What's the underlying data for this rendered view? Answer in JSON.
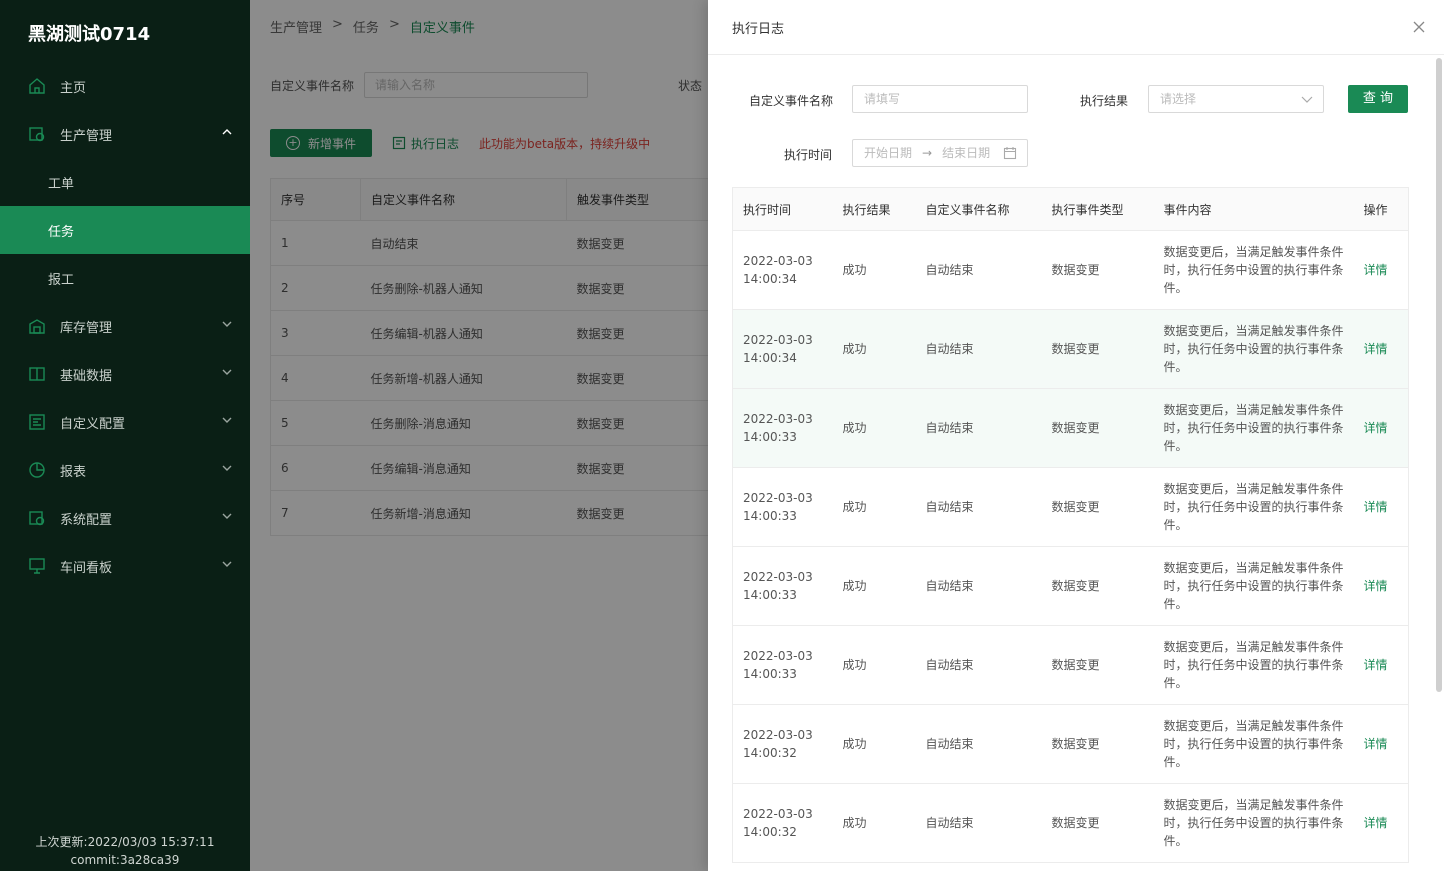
{
  "app": {
    "brand": "黑湖测试0714",
    "footer_update": "上次更新:2022/03/03 15:37:11",
    "footer_commit": "commit:3a28ca39"
  },
  "sidebar": {
    "items": [
      {
        "label": "主页",
        "icon": "home-icon"
      },
      {
        "label": "生产管理",
        "icon": "production-icon",
        "expanded": true
      },
      {
        "label": "工单",
        "sub": true
      },
      {
        "label": "任务",
        "sub": true,
        "active": true
      },
      {
        "label": "报工",
        "sub": true
      },
      {
        "label": "库存管理",
        "icon": "warehouse-icon"
      },
      {
        "label": "基础数据",
        "icon": "book-icon"
      },
      {
        "label": "自定义配置",
        "icon": "config-icon"
      },
      {
        "label": "报表",
        "icon": "chart-icon"
      },
      {
        "label": "系统配置",
        "icon": "settings-icon"
      },
      {
        "label": "车间看板",
        "icon": "monitor-icon"
      }
    ]
  },
  "breadcrumb": {
    "items": [
      "生产管理",
      "任务",
      "自定义事件"
    ],
    "sep": ">"
  },
  "main": {
    "filter_label": "自定义事件名称",
    "filter_placeholder": "请输入名称",
    "status_label": "状态",
    "add_button": "新增事件",
    "log_button": "执行日志",
    "beta_note": "此功能为beta版本，持续升级中",
    "table": {
      "headers": [
        "序号",
        "自定义事件名称",
        "触发事件类型"
      ],
      "rows": [
        [
          "1",
          "自动结束",
          "数据变更"
        ],
        [
          "2",
          "任务删除-机器人通知",
          "数据变更"
        ],
        [
          "3",
          "任务编辑-机器人通知",
          "数据变更"
        ],
        [
          "4",
          "任务新增-机器人通知",
          "数据变更"
        ],
        [
          "5",
          "任务删除-消息通知",
          "数据变更"
        ],
        [
          "6",
          "任务编辑-消息通知",
          "数据变更"
        ],
        [
          "7",
          "任务新增-消息通知",
          "数据变更"
        ]
      ]
    }
  },
  "drawer": {
    "title": "执行日志",
    "name_label": "自定义事件名称",
    "name_placeholder": "请填写",
    "result_label": "执行结果",
    "result_placeholder": "请选择",
    "query_button": "查 询",
    "time_label": "执行时间",
    "start_placeholder": "开始日期",
    "end_placeholder": "结束日期",
    "range_sep": "→",
    "table": {
      "headers": [
        "执行时间",
        "执行结果",
        "自定义事件名称",
        "执行事件类型",
        "事件内容",
        "操作"
      ],
      "rows": [
        {
          "date": "2022-03-03",
          "time": "14:00:34",
          "result": "成功",
          "name": "自动结束",
          "type": "数据变更",
          "content": "数据变更后，当满足触发事件条件时，执行任务中设置的执行事件条件。",
          "action": "详情"
        },
        {
          "date": "2022-03-03",
          "time": "14:00:34",
          "result": "成功",
          "name": "自动结束",
          "type": "数据变更",
          "content": "数据变更后，当满足触发事件条件时，执行任务中设置的执行事件条件。",
          "action": "详情"
        },
        {
          "date": "2022-03-03",
          "time": "14:00:33",
          "result": "成功",
          "name": "自动结束",
          "type": "数据变更",
          "content": "数据变更后，当满足触发事件条件时，执行任务中设置的执行事件条件。",
          "action": "详情"
        },
        {
          "date": "2022-03-03",
          "time": "14:00:33",
          "result": "成功",
          "name": "自动结束",
          "type": "数据变更",
          "content": "数据变更后，当满足触发事件条件时，执行任务中设置的执行事件条件。",
          "action": "详情"
        },
        {
          "date": "2022-03-03",
          "time": "14:00:33",
          "result": "成功",
          "name": "自动结束",
          "type": "数据变更",
          "content": "数据变更后，当满足触发事件条件时，执行任务中设置的执行事件条件。",
          "action": "详情"
        },
        {
          "date": "2022-03-03",
          "time": "14:00:33",
          "result": "成功",
          "name": "自动结束",
          "type": "数据变更",
          "content": "数据变更后，当满足触发事件条件时，执行任务中设置的执行事件条件。",
          "action": "详情"
        },
        {
          "date": "2022-03-03",
          "time": "14:00:32",
          "result": "成功",
          "name": "自动结束",
          "type": "数据变更",
          "content": "数据变更后，当满足触发事件条件时，执行任务中设置的执行事件条件。",
          "action": "详情"
        },
        {
          "date": "2022-03-03",
          "time": "14:00:32",
          "result": "成功",
          "name": "自动结束",
          "type": "数据变更",
          "content": "数据变更后，当满足触发事件条件时，执行任务中设置的执行事件条件。",
          "action": "详情"
        }
      ]
    }
  },
  "colors": {
    "accent": "#1a8a55",
    "sidebar_bg": "#0a1f15",
    "warning_text": "#e0413a"
  }
}
